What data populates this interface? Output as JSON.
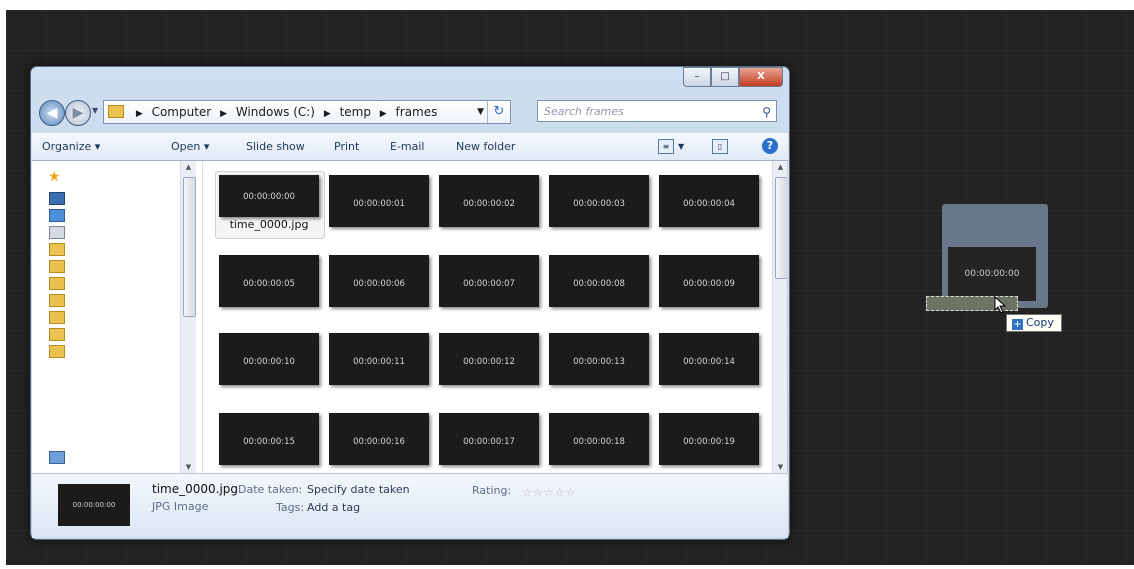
{
  "window": {
    "controls": {
      "minimize": "–",
      "maximize": "□",
      "close": "X"
    }
  },
  "address_bar": {
    "crumbs": [
      "Computer",
      "Windows (C:)",
      "temp",
      "frames"
    ],
    "search_placeholder": "Search frames"
  },
  "toolbar": {
    "organize": "Organize ▾",
    "open": "Open ▾",
    "slideshow": "Slide show",
    "print": "Print",
    "email": "E-mail",
    "new_folder": "New folder"
  },
  "thumbnails": [
    "00:00:00:00",
    "00:00:00:01",
    "00:00:00:02",
    "00:00:00:03",
    "00:00:00:04",
    "00:00:00:05",
    "00:00:00:06",
    "00:00:00:07",
    "00:00:00:08",
    "00:00:00:09",
    "00:00:00:10",
    "00:00:00:11",
    "00:00:00:12",
    "00:00:00:13",
    "00:00:00:14",
    "00:00:00:15",
    "00:00:00:16",
    "00:00:00:17",
    "00:00:00:18",
    "00:00:00:19"
  ],
  "selected_file": "time_0000.jpg",
  "details": {
    "thumb_label": "00:00:00:00",
    "filename": "time_0000.jpg",
    "filetype": "JPG Image",
    "date_taken_label": "Date taken:",
    "date_taken_value": "Specify date taken",
    "tags_label": "Tags:",
    "tags_value": "Add a tag",
    "rating_label": "Rating:",
    "rating_stars": "☆☆☆☆☆"
  },
  "drop_target": {
    "timecode": "00:00:00:00",
    "copy_label": "Copy"
  }
}
